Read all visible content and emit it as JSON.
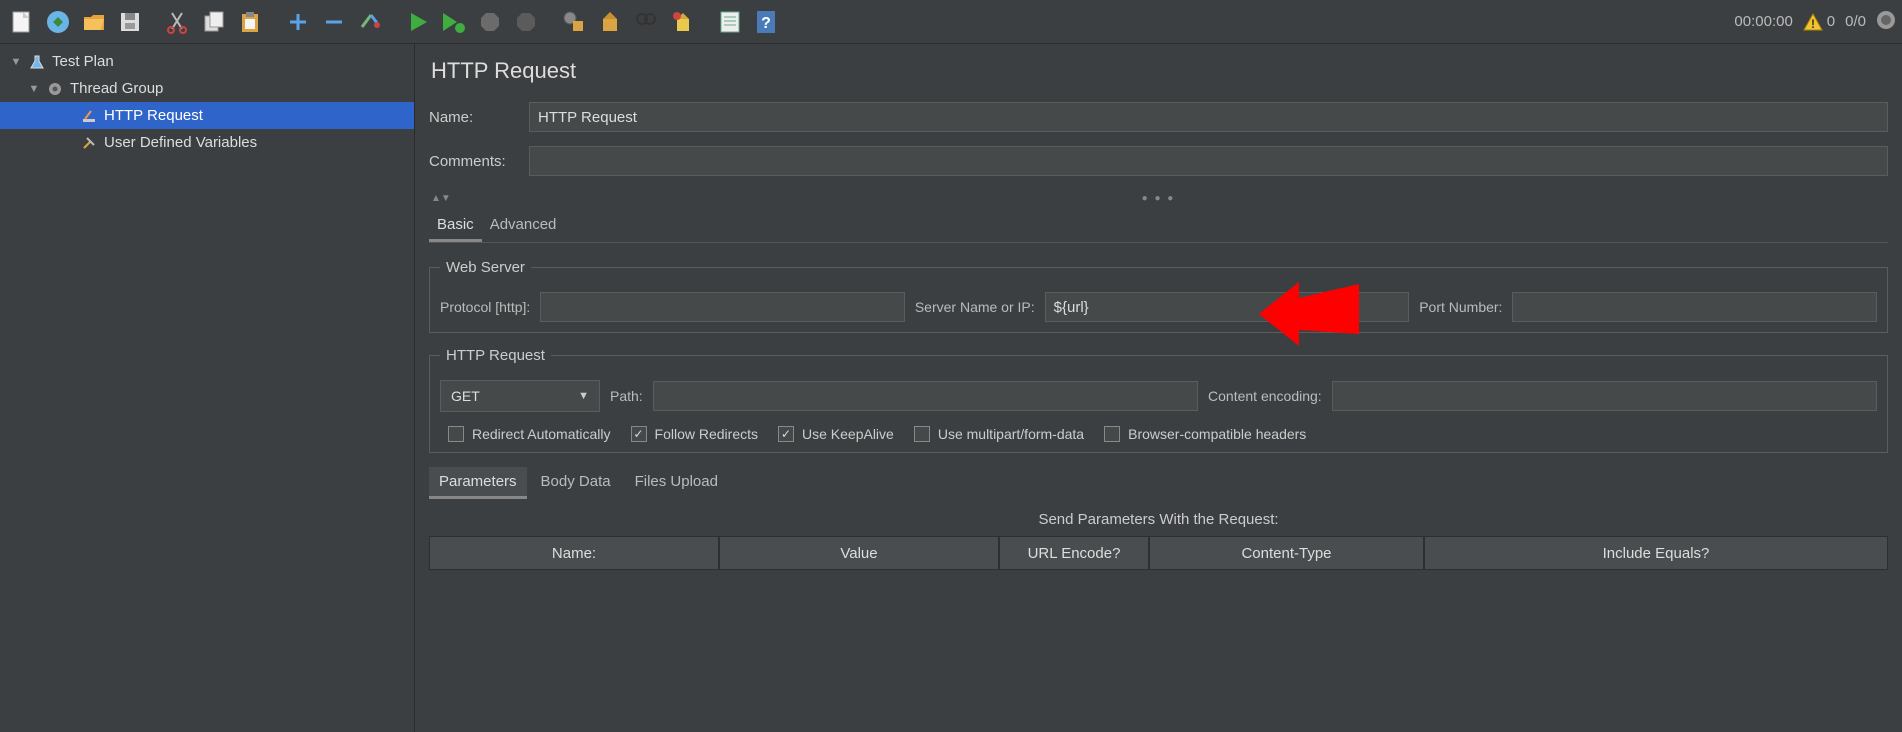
{
  "status": {
    "time": "00:00:00",
    "warn_count": "0",
    "threads": "0/0"
  },
  "tree": {
    "root": "Test Plan",
    "group": "Thread Group",
    "item1": "HTTP Request",
    "item2": "User Defined Variables"
  },
  "panel": {
    "title": "HTTP Request",
    "name_label": "Name:",
    "name_value": "HTTP Request",
    "comments_label": "Comments:",
    "comments_value": "",
    "tabs": {
      "basic": "Basic",
      "advanced": "Advanced"
    },
    "webserver": {
      "legend": "Web Server",
      "protocol_label": "Protocol [http]:",
      "protocol_value": "",
      "server_label": "Server Name or IP:",
      "server_value": "${url}",
      "port_label": "Port Number:",
      "port_value": ""
    },
    "httpreq": {
      "legend": "HTTP Request",
      "method": "GET",
      "path_label": "Path:",
      "path_value": "",
      "encoding_label": "Content encoding:",
      "encoding_value": "",
      "checks": {
        "redirect_auto": "Redirect Automatically",
        "follow_redirects": "Follow Redirects",
        "keepalive": "Use KeepAlive",
        "multipart": "Use multipart/form-data",
        "browser_compat": "Browser-compatible headers"
      }
    },
    "subtabs": {
      "params": "Parameters",
      "body": "Body Data",
      "files": "Files Upload"
    },
    "params_title": "Send Parameters With the Request:",
    "columns": {
      "name": "Name:",
      "value": "Value",
      "url_encode": "URL Encode?",
      "content_type": "Content-Type",
      "include_equals": "Include Equals?"
    }
  }
}
